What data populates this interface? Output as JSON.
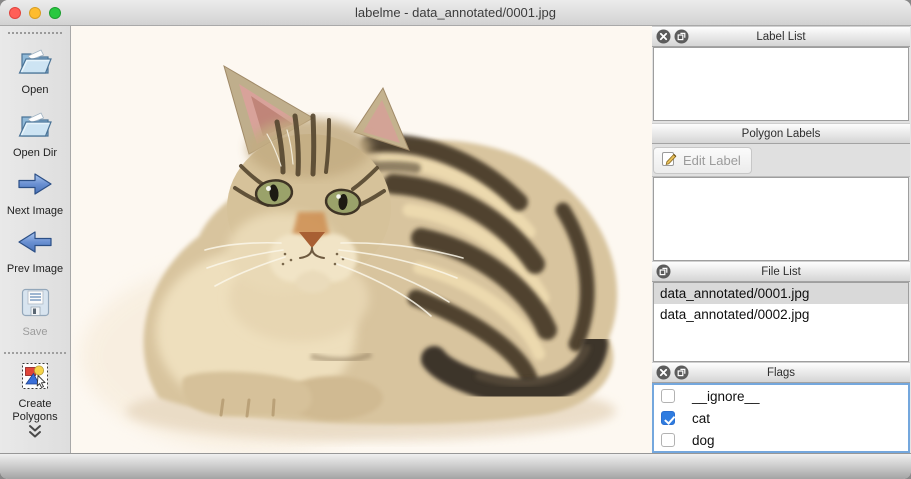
{
  "window": {
    "title": "labelme - data_annotated/0001.jpg",
    "traffic_lights": {
      "close": "#ff5f57",
      "minimize": "#febc2e",
      "zoom": "#28c840"
    }
  },
  "toolbar": {
    "items": [
      {
        "label": "Open",
        "icon": "open-folder-icon",
        "disabled": false
      },
      {
        "label": "Open Dir",
        "icon": "open-dir-folder-icon",
        "disabled": false
      },
      {
        "label": "Next Image",
        "icon": "arrow-right-icon",
        "disabled": false
      },
      {
        "label": "Prev Image",
        "icon": "arrow-left-icon",
        "disabled": false
      },
      {
        "label": "Save",
        "icon": "floppy-disk-icon",
        "disabled": true
      },
      {
        "label": "Create\nPolygons",
        "icon": "create-polygons-icon",
        "disabled": false
      }
    ],
    "overflow_icon": "chevron-double-down-icon"
  },
  "canvas": {
    "image_alt": "tabby kitten lying on a white background"
  },
  "panels": {
    "label_list": {
      "title": "Label List",
      "buttons": [
        "close",
        "float"
      ],
      "items": []
    },
    "polygon_labels": {
      "title": "Polygon Labels",
      "edit_button_label": "Edit Label",
      "items": []
    },
    "file_list": {
      "title": "File List",
      "buttons": [
        "float"
      ],
      "items": [
        {
          "name": "data_annotated/0001.jpg",
          "selected": true
        },
        {
          "name": "data_annotated/0002.jpg",
          "selected": false
        }
      ]
    },
    "flags": {
      "title": "Flags",
      "buttons": [
        "close",
        "float"
      ],
      "items": [
        {
          "label": "__ignore__",
          "checked": false
        },
        {
          "label": "cat",
          "checked": true
        },
        {
          "label": "dog",
          "checked": false
        }
      ]
    }
  },
  "colors": {
    "accent_blue": "#2f7ce0",
    "focus_border": "#74a7dd",
    "selection_gray": "#d9d9d9",
    "canvas_background": "#fdf8f1"
  }
}
